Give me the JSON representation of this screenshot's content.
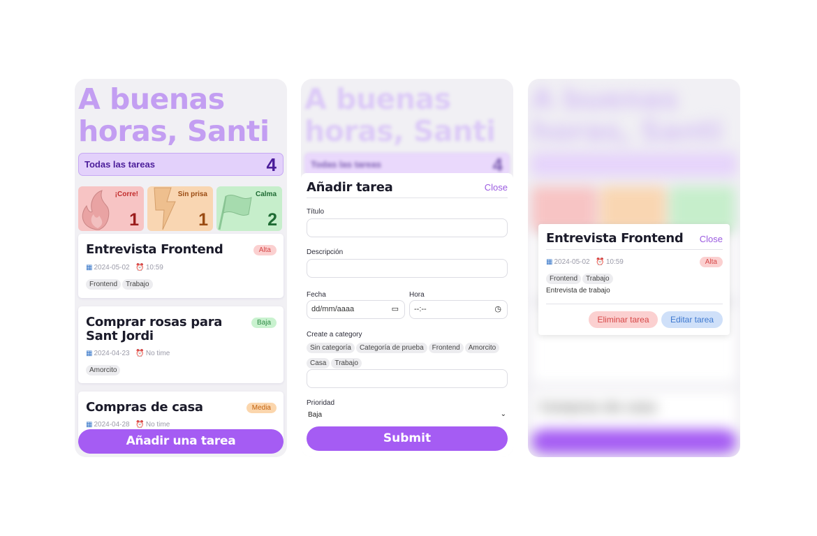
{
  "greeting": "A buenas horas, Santi",
  "all_tasks": {
    "label": "Todas las tareas",
    "count": "4"
  },
  "categories": [
    {
      "label": "¡Corre!",
      "count": "1",
      "color": "#f7c4c4",
      "icon": "fire-icon"
    },
    {
      "label": "Sin prisa",
      "count": "1",
      "color": "#f9d6b2",
      "icon": "lightning-icon"
    },
    {
      "label": "Calma",
      "count": "2",
      "color": "#c6eecb",
      "icon": "flag-icon"
    }
  ],
  "tasks": [
    {
      "title": "Entrevista Frontend",
      "date": "2024-05-02",
      "time": "10:59",
      "priority": "Alta",
      "tags": [
        "Frontend",
        "Trabajo"
      ]
    },
    {
      "title": "Comprar rosas para Sant Jordi",
      "date": "2024-04-23",
      "time": "No time",
      "priority": "Baja",
      "tags": [
        "Amorcito"
      ]
    },
    {
      "title": "Compras de casa",
      "date": "2024-04-28",
      "time": "No time",
      "priority": "Media",
      "tags": []
    }
  ],
  "add_button": "Añadir una tarea",
  "form": {
    "title": "Añadir tarea",
    "close": "Close",
    "titulo_label": "Título",
    "descripcion_label": "Descripción",
    "fecha_label": "Fecha",
    "fecha_placeholder": "dd/mm/aaaa",
    "hora_label": "Hora",
    "hora_placeholder": "--:--",
    "category_label": "Create a category",
    "category_chips": [
      "Sin categoría",
      "Categoría de prueba",
      "Frontend",
      "Amorcito",
      "Casa",
      "Trabajo"
    ],
    "prioridad_label": "Prioridad",
    "prioridad_value": "Baja",
    "submit": "Submit"
  },
  "modal": {
    "title": "Entrevista Frontend",
    "close": "Close",
    "date": "2024-05-02",
    "time": "10:59",
    "priority": "Alta",
    "tags": [
      "Frontend",
      "Trabajo"
    ],
    "description": "Entrevista de trabajo",
    "delete_label": "Eliminar tarea",
    "edit_label": "Editar tarea"
  },
  "colors": {
    "accent": "#a55cf3",
    "heading": "#c39ef2",
    "bar": "#e3d1fb"
  }
}
